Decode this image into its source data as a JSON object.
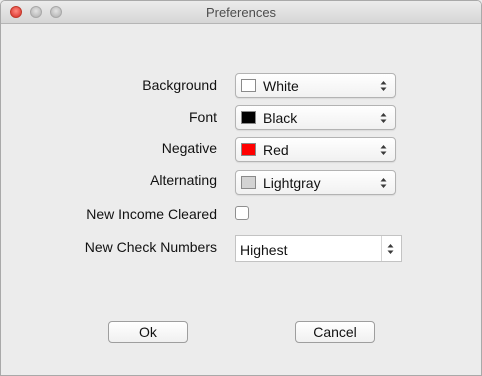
{
  "window": {
    "title": "Preferences"
  },
  "colors": {
    "background_swatch": "#ffffff",
    "font_swatch": "#000000",
    "negative_swatch": "#ff0000",
    "alternating_swatch": "#d3d3d3"
  },
  "form": {
    "background": {
      "label": "Background",
      "value": "White"
    },
    "font": {
      "label": "Font",
      "value": "Black"
    },
    "negative": {
      "label": "Negative",
      "value": "Red"
    },
    "alternating": {
      "label": "Alternating",
      "value": "Lightgray"
    },
    "new_income_cleared": {
      "label": "New Income Cleared",
      "checked": false
    },
    "new_check_numbers": {
      "label": "New Check Numbers",
      "value": "Highest"
    }
  },
  "buttons": {
    "ok": "Ok",
    "cancel": "Cancel"
  }
}
